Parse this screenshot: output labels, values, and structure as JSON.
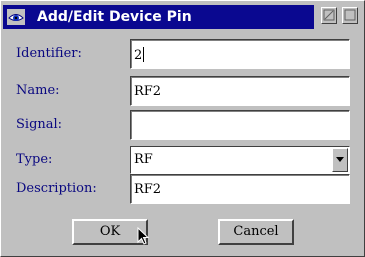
{
  "window": {
    "title": "Add/Edit Device Pin"
  },
  "icons": {
    "app": "eye-icon",
    "maximize": "maximize-icon",
    "close": "close-icon",
    "dropdown": "chevron-down-icon",
    "pointer": "mouse-pointer-icon"
  },
  "form": {
    "identifier": {
      "label": "Identifier:",
      "value": "2"
    },
    "name": {
      "label": "Name:",
      "value": "RF2"
    },
    "signal": {
      "label": "Signal:",
      "value": ""
    },
    "type": {
      "label": "Type:",
      "value": "RF"
    },
    "description": {
      "label": "Description:",
      "value": "RF2"
    }
  },
  "buttons": {
    "ok": "OK",
    "cancel": "Cancel"
  },
  "colors": {
    "titlebar": "#0a0890",
    "label_text": "#0a0880",
    "window_bg": "#c0c0c0"
  }
}
